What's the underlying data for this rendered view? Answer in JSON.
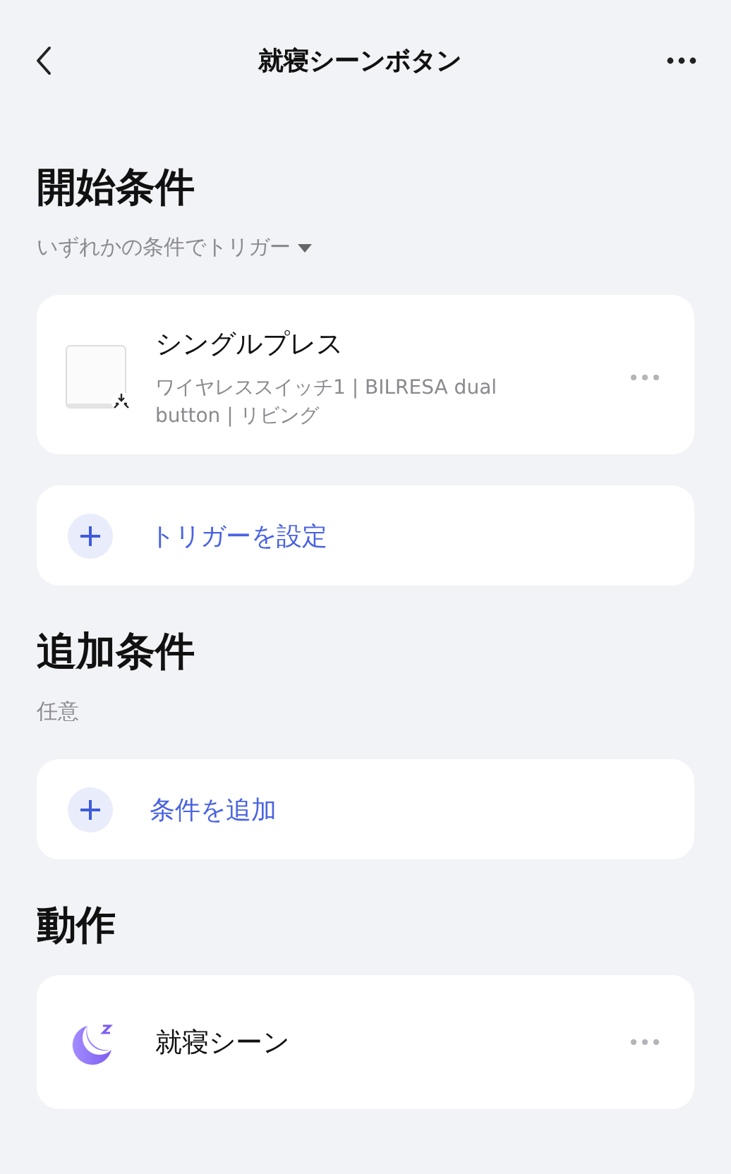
{
  "header": {
    "title": "就寝シーンボタン"
  },
  "sections": [
    {
      "title": "開始条件",
      "subtitle": "いずれかの条件でトリガー",
      "dropdown": true,
      "items": [
        {
          "kind": "device",
          "title": "シングルプレス",
          "detail": "ワイヤレススイッチ1 | BILRESA dual button | リビング"
        },
        {
          "kind": "add",
          "label": "トリガーを設定"
        }
      ]
    },
    {
      "title": "追加条件",
      "subtitle": "任意",
      "dropdown": false,
      "items": [
        {
          "kind": "add",
          "label": "条件を追加"
        }
      ]
    },
    {
      "title": "動作",
      "items": [
        {
          "kind": "scene",
          "title": "就寝シーン"
        }
      ]
    }
  ]
}
